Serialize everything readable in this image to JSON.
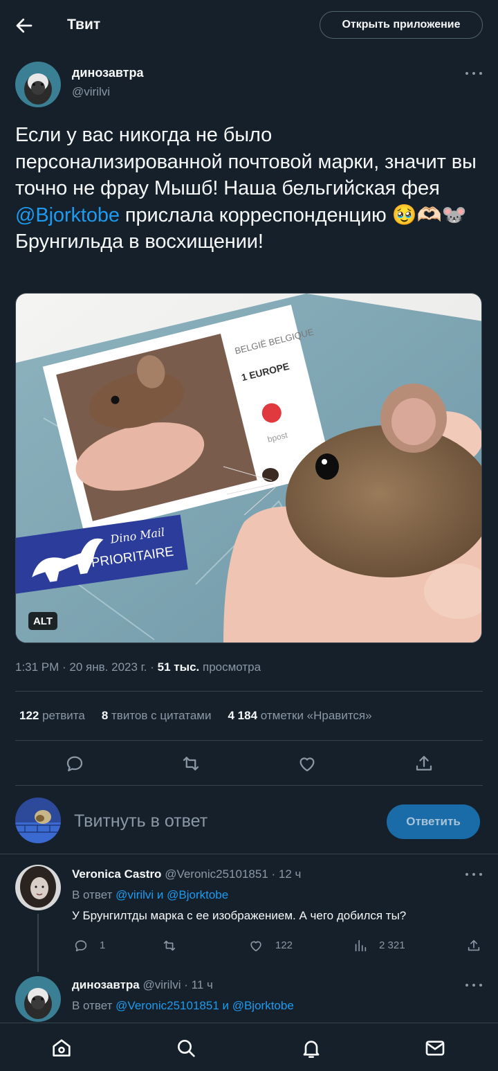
{
  "header": {
    "title": "Твит",
    "open_app": "Открыть приложение"
  },
  "tweet": {
    "author_name": "динозавтра",
    "author_handle": "@virilvi",
    "text_before": "Если у вас никогда не было персонализированной почтовой марки, значит вы точно не фрау Мышб! Наша бельгийская фея ",
    "mention": "@Bjorktobe",
    "text_after": " прислала корреспонденцию 🥹🫶🏻🐭 Брунгильда в восхищении!",
    "alt_badge": "ALT",
    "time": "1:31 PM",
    "sep1": " · ",
    "date": "20 янв. 2023 г.",
    "sep2": " · ",
    "views_count": "51 тыс.",
    "views_label": " просмотра",
    "retweets_count": "122",
    "retweets_label": " ретвита",
    "quotes_count": "8",
    "quotes_label": " твитов с цитатами",
    "likes_count": "4 184",
    "likes_label": " отметки «Нравится»",
    "image": {
      "stamp_country": "BELGIË BELGIQUE",
      "stamp_value": "1 EUROPE",
      "stamp_brand": "bpost",
      "label_script": "Dino Mail",
      "label_main": "PRIORITAIRE"
    }
  },
  "compose": {
    "placeholder": "Твитнуть в ответ",
    "button": "Ответить"
  },
  "replies": [
    {
      "name": "Veronica Castro",
      "handle": "@Veronic25101851",
      "time": "· 12 ч",
      "reply_prefix": "В ответ ",
      "reply_to": "@virilvi и @Bjorktobe",
      "text": "У Брунгилтды марка с ее изображением. А чего добился ты?",
      "replies": "1",
      "likes": "122",
      "views": "2 321"
    },
    {
      "name": "динозавтра",
      "handle": "@virilvi",
      "time": "· 11 ч",
      "reply_prefix": "В ответ ",
      "reply_to": "@Veronic25101851 и @Bjorktobe"
    }
  ],
  "colors": {
    "background": "#15202b",
    "accent": "#1d9bf0",
    "muted": "#8b98a5",
    "divider": "#38444d"
  },
  "icons": [
    "back-arrow-icon",
    "more-icon",
    "reply-icon",
    "retweet-icon",
    "like-icon",
    "share-icon",
    "views-icon",
    "home-icon",
    "search-icon",
    "notifications-icon",
    "messages-icon"
  ]
}
